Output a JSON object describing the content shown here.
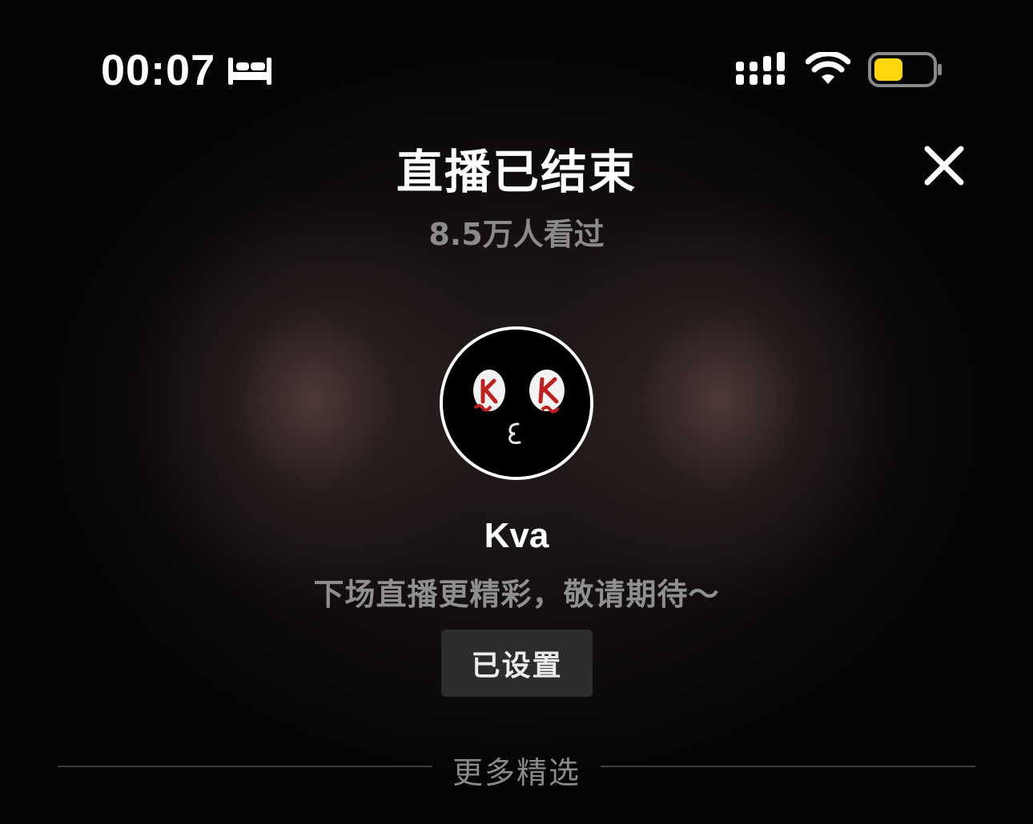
{
  "status_bar": {
    "time": "00:07",
    "focus_mode_icon": "bed-icon",
    "signal_icon": "cellular-signal-icon",
    "wifi_icon": "wifi-icon",
    "battery_icon": "battery-icon",
    "battery_color": "#ffd60a",
    "battery_level": 0.5
  },
  "header": {
    "title": "直播已结束",
    "close_icon": "close-icon",
    "viewer_count": "8.5万人看过"
  },
  "streamer": {
    "name": "Kva",
    "avatar_icon": "avatar-face-icon",
    "notice": "下场直播更精彩，敬请期待～",
    "reminder_button": "已设置"
  },
  "more_section": {
    "label": "更多精选"
  },
  "colors": {
    "accent_red": "#c0201c",
    "background": "#060505"
  }
}
